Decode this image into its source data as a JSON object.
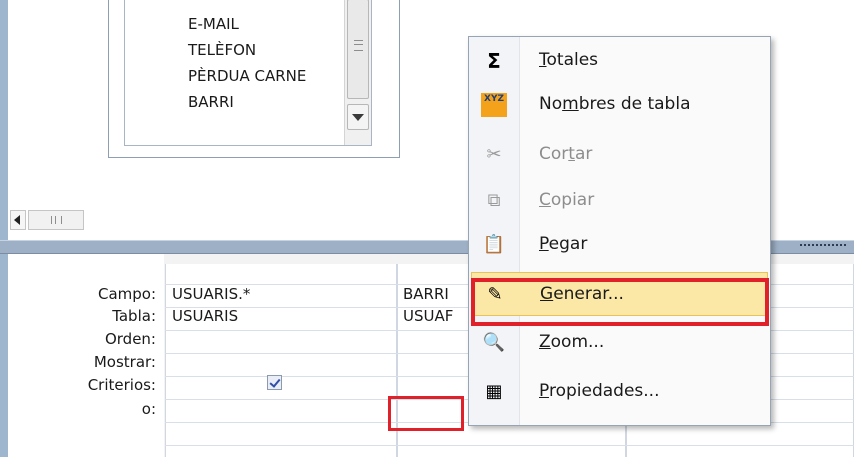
{
  "field_list": {
    "items": [
      "E-MAIL",
      "TELÈFON",
      "PÈRDUA CARNE",
      "BARRI"
    ]
  },
  "grid": {
    "row_labels": [
      "Campo:",
      "Tabla:",
      "Orden:",
      "Mostrar:",
      "Criterios:",
      "o:"
    ],
    "columns": [
      {
        "campo": "USUARIS.*",
        "tabla": "USUARIS",
        "mostrar": true
      },
      {
        "campo": "BARRI",
        "tabla": "USUAF"
      }
    ]
  },
  "context_menu": {
    "items": [
      {
        "icon": "sigma-icon",
        "glyph": "Σ",
        "pre": "",
        "u": "T",
        "post": "otales",
        "enabled": true
      },
      {
        "icon": "table-names-icon",
        "glyph": "XYZ",
        "pre": "No",
        "u": "m",
        "post": "bres de tabla",
        "enabled": true
      },
      {
        "icon": "scissors-icon",
        "glyph": "✂",
        "pre": "Cor",
        "u": "t",
        "post": "ar",
        "enabled": false
      },
      {
        "icon": "copy-icon",
        "glyph": "⧉",
        "pre": "",
        "u": "C",
        "post": "opiar",
        "enabled": false
      },
      {
        "icon": "paste-icon",
        "glyph": "📋",
        "pre": "",
        "u": "P",
        "post": "egar",
        "enabled": true
      },
      {
        "icon": "build-wand-icon",
        "glyph": "✎",
        "pre": "",
        "u": "G",
        "post": "enerar...",
        "enabled": true,
        "highlighted": true
      },
      {
        "icon": "zoom-icon",
        "glyph": "🔍",
        "pre": "",
        "u": "Z",
        "post": "oom...",
        "enabled": true
      },
      {
        "icon": "properties-icon",
        "glyph": "▦",
        "pre": "",
        "u": "P",
        "post": "ropiedades...",
        "enabled": true
      }
    ]
  },
  "colors": {
    "highlight_border": "#e0212a",
    "menu_hover": "#fbe7a6",
    "frame_blue": "#9eb6ce"
  }
}
